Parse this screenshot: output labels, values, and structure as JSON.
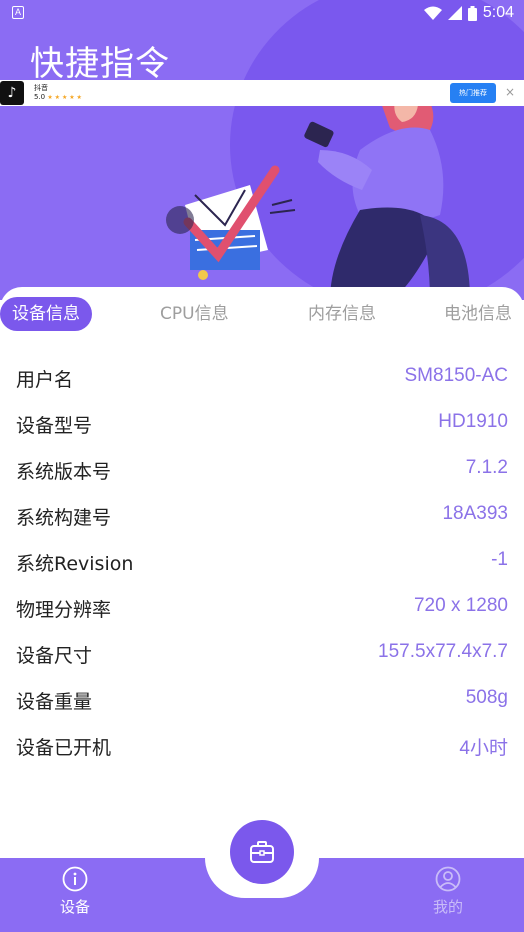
{
  "status_bar": {
    "left_icon": "A",
    "time": "5:04",
    "icons": [
      "wifi-icon",
      "signal-icon",
      "battery-icon"
    ]
  },
  "app": {
    "title": "快捷指令"
  },
  "ad": {
    "app_name": "抖音",
    "rating": "5.0",
    "button_label": "热门推荐",
    "close": "×"
  },
  "tabs": [
    {
      "label": "设备信息",
      "active": true
    },
    {
      "label": "CPU信息",
      "active": false
    },
    {
      "label": "内存信息",
      "active": false
    },
    {
      "label": "电池信息",
      "active": false
    }
  ],
  "device_info": [
    {
      "label": "用户名",
      "value": "SM8150-AC"
    },
    {
      "label": "设备型号",
      "value": "HD1910"
    },
    {
      "label": "系统版本号",
      "value": "7.1.2"
    },
    {
      "label": "系统构建号",
      "value": "18A393"
    },
    {
      "label": "系统Revision",
      "value": "-1"
    },
    {
      "label": "物理分辨率",
      "value": "720 x 1280"
    },
    {
      "label": "设备尺寸",
      "value": "157.5x77.4x7.7"
    },
    {
      "label": "设备重量",
      "value": "508g"
    },
    {
      "label": "设备已开机",
      "value": "4小时"
    }
  ],
  "bottom_nav": {
    "device_label": "设备",
    "mine_label": "我的",
    "fab_icon": "toolbox-icon"
  },
  "colors": {
    "primary": "#8b6cf3",
    "accent": "#7b58ec",
    "value_text": "#8b72e8"
  }
}
